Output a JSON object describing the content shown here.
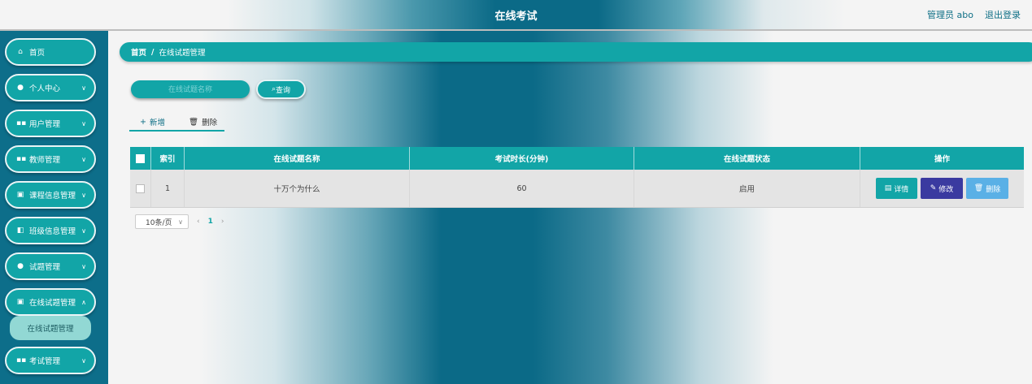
{
  "header": {
    "title": "在线考试",
    "user": "管理员 abo",
    "logout": "退出登录"
  },
  "sidebar": {
    "items": [
      {
        "label": "首页",
        "icon": "home-icon"
      },
      {
        "label": "个人中心",
        "icon": "user-icon"
      },
      {
        "label": "用户管理",
        "icon": "grid-icon"
      },
      {
        "label": "教师管理",
        "icon": "grid-icon"
      },
      {
        "label": "课程信息管理",
        "icon": "clipboard-icon"
      },
      {
        "label": "班级信息管理",
        "icon": "class-icon"
      },
      {
        "label": "试题管理",
        "icon": "pin-icon"
      },
      {
        "label": "在线试题管理",
        "icon": "doc-icon"
      },
      {
        "label": "考试管理",
        "icon": "grid-icon"
      }
    ],
    "active_sub": "在线试题管理"
  },
  "breadcrumb": {
    "home": "首页",
    "sep": "/",
    "current": "在线试题管理"
  },
  "search": {
    "placeholder": "在线试题名称",
    "button": "查询"
  },
  "actions": {
    "add": "新增",
    "delete": "删除"
  },
  "table": {
    "headers": {
      "index": "索引",
      "name": "在线试题名称",
      "duration": "考试时长(分钟)",
      "status": "在线试题状态",
      "ops": "操作"
    },
    "rows": [
      {
        "index": "1",
        "name": "十万个为什么",
        "duration": "60",
        "status": "启用"
      }
    ],
    "buttons": {
      "detail": "详情",
      "edit": "修改",
      "remove": "删除"
    }
  },
  "pagination": {
    "page_size": "10条/页",
    "current": "1"
  }
}
